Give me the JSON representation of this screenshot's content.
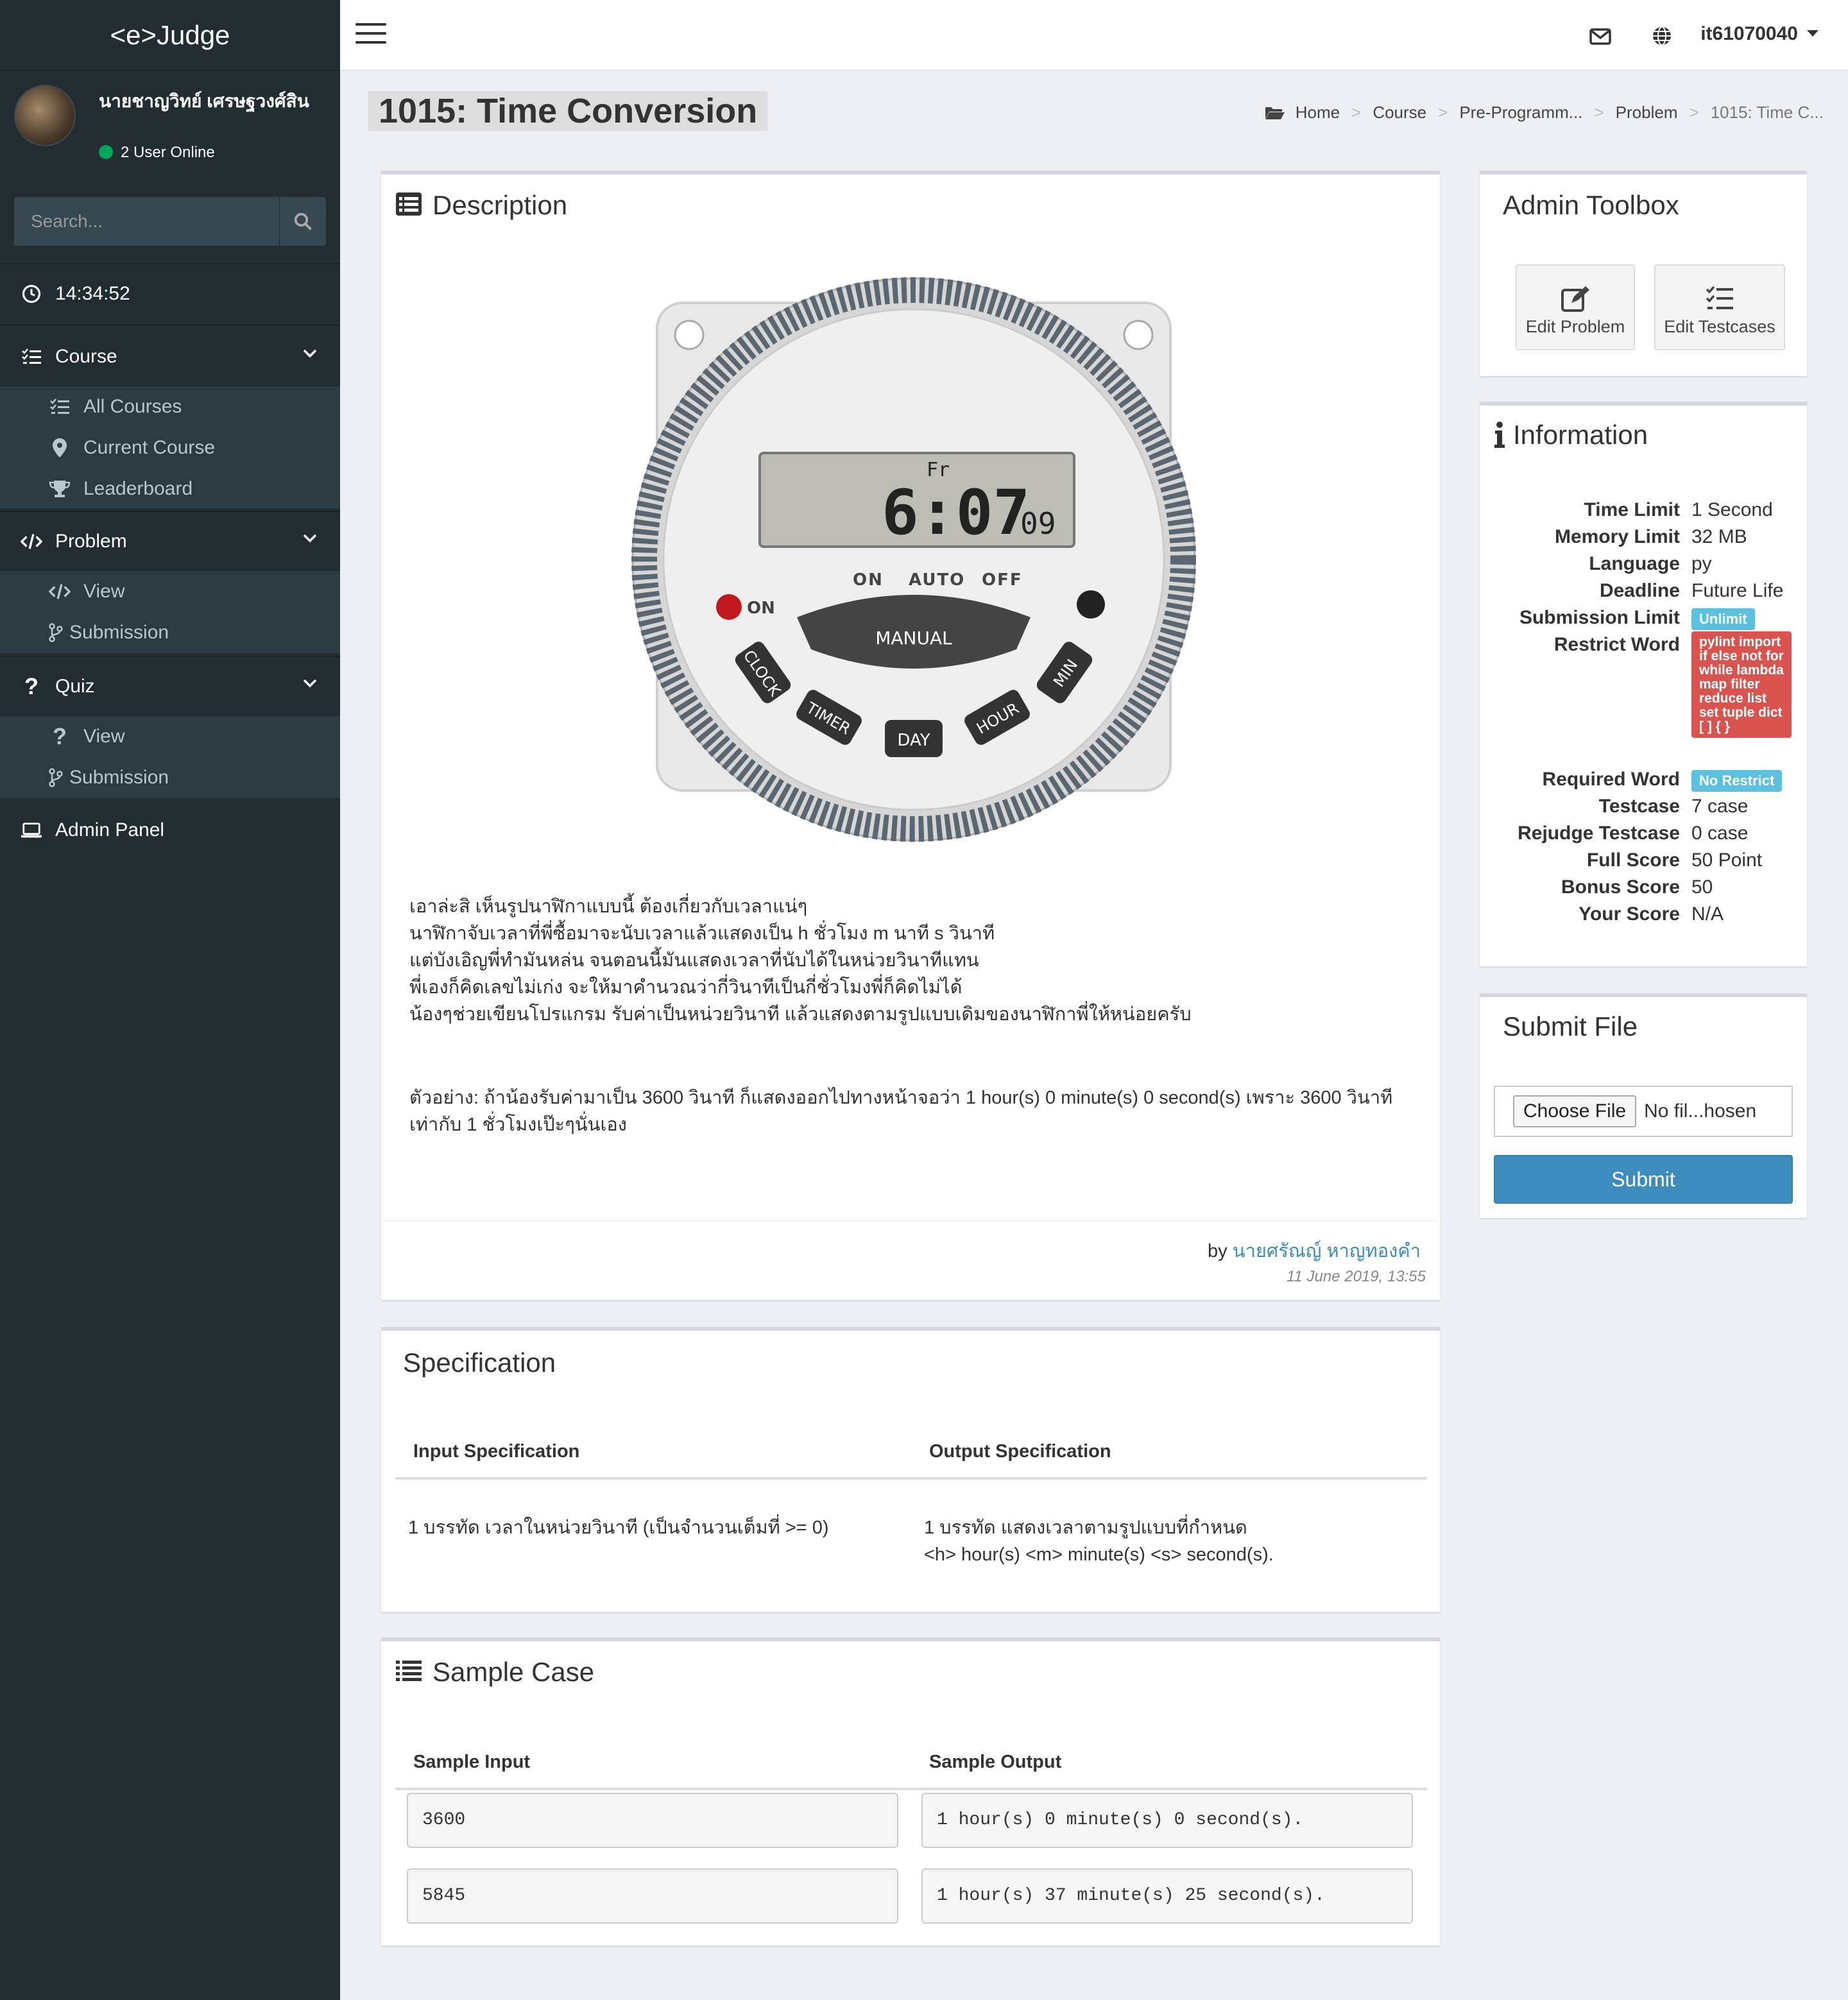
{
  "app": {
    "logo": "<e>Judge"
  },
  "user": {
    "name": "นายชาญวิทย์ เศรษฐวงศ์สิน",
    "online": "2 User Online",
    "top_username": "it61070040"
  },
  "search": {
    "placeholder": "Search..."
  },
  "sidebar": {
    "clock": "14:34:52",
    "course": {
      "label": "Course",
      "items": [
        "All Courses",
        "Current Course",
        "Leaderboard"
      ]
    },
    "problem": {
      "label": "Problem",
      "items": [
        "View",
        "Submission"
      ]
    },
    "quiz": {
      "label": "Quiz",
      "items": [
        "View",
        "Submission"
      ]
    },
    "admin": "Admin Panel"
  },
  "page": {
    "title": "1015: Time Conversion",
    "breadcrumb": [
      "Home",
      "Course",
      "Pre-Programm...",
      "Problem",
      "1015: Time C..."
    ]
  },
  "description": {
    "title": "Description",
    "image": {
      "lcd_day": "Fr",
      "lcd_time": "6:07",
      "lcd_sec": "09",
      "mode_labels": [
        "ON",
        "AUTO",
        "OFF"
      ],
      "on_label": "ON",
      "buttons": [
        "MANUAL",
        "CLOCK",
        "TIMER",
        "DAY",
        "HOUR",
        "MIN"
      ]
    },
    "lines": [
      "เอาล่ะสิ เห็นรูปนาฬิกาแบบนี้ ต้องเกี่ยวกับเวลาแน่ๆ",
      "นาฬิกาจับเวลาที่พี่ซื้อมาจะนับเวลาแล้วแสดงเป็น h ชั่วโมง m นาที s วินาที",
      "แต่บังเอิญพี่ทำมันหล่น จนตอนนี้มันแสดงเวลาที่นับได้ในหน่วยวินาทีแทน",
      "พี่เองก็คิดเลขไม่เก่ง จะให้มาคำนวณว่ากี่วินาทีเป็นกี่ชั่วโมงพี่ก็คิดไม่ได้",
      "น้องๆช่วยเขียนโปรแกรม รับค่าเป็นหน่วยวินาที แล้วแสดงตามรูปแบบเดิมของนาฬิกาพี่ให้หน่อยครับ"
    ],
    "example_lines": [
      "ตัวอย่าง: ถ้าน้องรับค่ามาเป็น 3600 วินาที ก็แสดงออกไปทางหน้าจอว่า 1 hour(s) 0 minute(s) 0 second(s) เพราะ 3600 วินาที",
      "เท่ากับ 1 ชั่วโมงเป๊ะๆนั่นเอง"
    ],
    "by_label": "by",
    "author": "นายศรัณญ์ หาญทองคำ",
    "date": "11 June 2019, 13:55"
  },
  "specification": {
    "title": "Specification",
    "input_header": "Input Specification",
    "output_header": "Output Specification",
    "input_text": "1 บรรทัด เวลาในหน่วยวินาที (เป็นจำนวนเต็มที่ >= 0)",
    "output_text_1": "1 บรรทัด แสดงเวลาตามรูปแบบที่กำหนด",
    "output_text_2": "<h> hour(s) <m> minute(s) <s> second(s)."
  },
  "sample": {
    "title": "Sample Case",
    "input_header": "Sample Input",
    "output_header": "Sample Output",
    "cases": [
      {
        "input": "3600",
        "output": "1 hour(s) 0 minute(s) 0 second(s)."
      },
      {
        "input": "5845",
        "output": "1 hour(s) 37 minute(s) 25 second(s)."
      }
    ]
  },
  "toolbox": {
    "title": "Admin Toolbox",
    "edit_problem": "Edit Problem",
    "edit_testcases": "Edit Testcases"
  },
  "information": {
    "title": "Information",
    "time_limit": {
      "k": "Time Limit",
      "v": "1 Second"
    },
    "memory_limit": {
      "k": "Memory Limit",
      "v": "32 MB"
    },
    "language": {
      "k": "Language",
      "v": "py"
    },
    "deadline": {
      "k": "Deadline",
      "v": "Future Life"
    },
    "submission_limit": {
      "k": "Submission Limit",
      "v": "Unlimit"
    },
    "restrict_word": {
      "k": "Restrict Word",
      "v": "pylint import if else not for while lambda map filter reduce list set tuple dict [ ] { }"
    },
    "required_word": {
      "k": "Required Word",
      "v": "No Restrict"
    },
    "testcase": {
      "k": "Testcase",
      "v": "7 case"
    },
    "rejudge_testcase": {
      "k": "Rejudge Testcase",
      "v": "0 case"
    },
    "full_score": {
      "k": "Full Score",
      "v": "50 Point"
    },
    "bonus_score": {
      "k": "Bonus Score",
      "v": "50"
    },
    "your_score": {
      "k": "Your Score",
      "v": "N/A"
    }
  },
  "submit": {
    "title": "Submit File",
    "choose": "Choose File",
    "no_file": "No fil...hosen",
    "button": "Submit"
  },
  "colors": {
    "sidebar_bg": "#222d32",
    "sidebar_sub_bg": "#2c3b41",
    "accent": "#3c8dbc",
    "online": "#00a65a",
    "label_info": "#5bc0de",
    "label_danger": "#d9534f"
  }
}
